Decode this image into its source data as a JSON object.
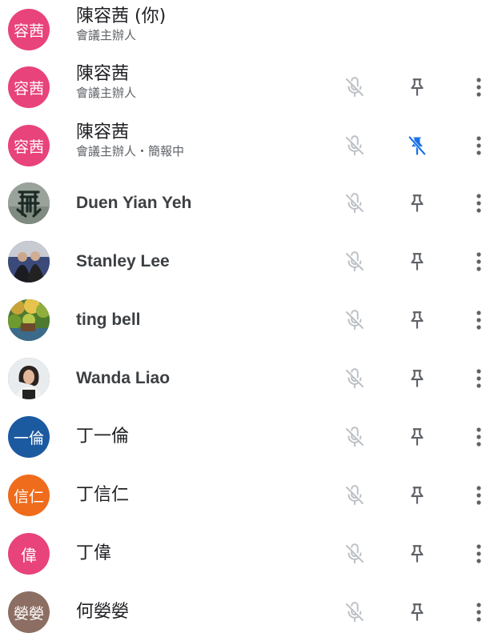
{
  "participants": [
    {
      "name": "陳容茜 (你)",
      "subtitle": "會議主辦人",
      "avatar": {
        "type": "initials",
        "text": "容茜",
        "color": "#e8437a"
      },
      "show_controls": false,
      "pinned": false
    },
    {
      "name": "陳容茜",
      "subtitle": "會議主辦人",
      "avatar": {
        "type": "initials",
        "text": "容茜",
        "color": "#e8437a"
      },
      "show_controls": true,
      "pinned": false
    },
    {
      "name": "陳容茜",
      "subtitle": "會議主辦人・簡報中",
      "avatar": {
        "type": "initials",
        "text": "容茜",
        "color": "#e8437a"
      },
      "show_controls": true,
      "pinned": true
    },
    {
      "name": "Duen Yian Yeh",
      "subtitle": "",
      "avatar": {
        "type": "photo",
        "icon": "calligraphy-photo"
      },
      "show_controls": true,
      "pinned": false
    },
    {
      "name": "Stanley Lee",
      "subtitle": "",
      "avatar": {
        "type": "photo",
        "icon": "group-photo"
      },
      "show_controls": true,
      "pinned": false
    },
    {
      "name": "ting bell",
      "subtitle": "",
      "avatar": {
        "type": "photo",
        "icon": "garden-photo"
      },
      "show_controls": true,
      "pinned": false
    },
    {
      "name": "Wanda Liao",
      "subtitle": "",
      "avatar": {
        "type": "photo",
        "icon": "portrait-photo"
      },
      "show_controls": true,
      "pinned": false
    },
    {
      "name": "丁一倫",
      "subtitle": "",
      "avatar": {
        "type": "initials",
        "text": "一倫",
        "color": "#1c5aa0"
      },
      "show_controls": true,
      "pinned": false
    },
    {
      "name": "丁信仁",
      "subtitle": "",
      "avatar": {
        "type": "initials",
        "text": "信仁",
        "color": "#ef6c1c"
      },
      "show_controls": true,
      "pinned": false
    },
    {
      "name": "丁偉",
      "subtitle": "",
      "avatar": {
        "type": "initials",
        "text": "偉",
        "color": "#e8437a"
      },
      "show_controls": true,
      "pinned": false
    },
    {
      "name": "何嫈嫈",
      "subtitle": "",
      "avatar": {
        "type": "initials",
        "text": "嫈嫈",
        "color": "#8d6e63"
      },
      "show_controls": true,
      "pinned": false
    }
  ],
  "icons": {
    "mic_off": "mic-off-icon",
    "pin": "pin-icon",
    "pin_active": "pinned-icon",
    "more": "more-vert-icon"
  },
  "colors": {
    "icon_gray": "#5f6368",
    "mic_off_gray": "#bdc1c6",
    "pin_active": "#1a73e8"
  }
}
